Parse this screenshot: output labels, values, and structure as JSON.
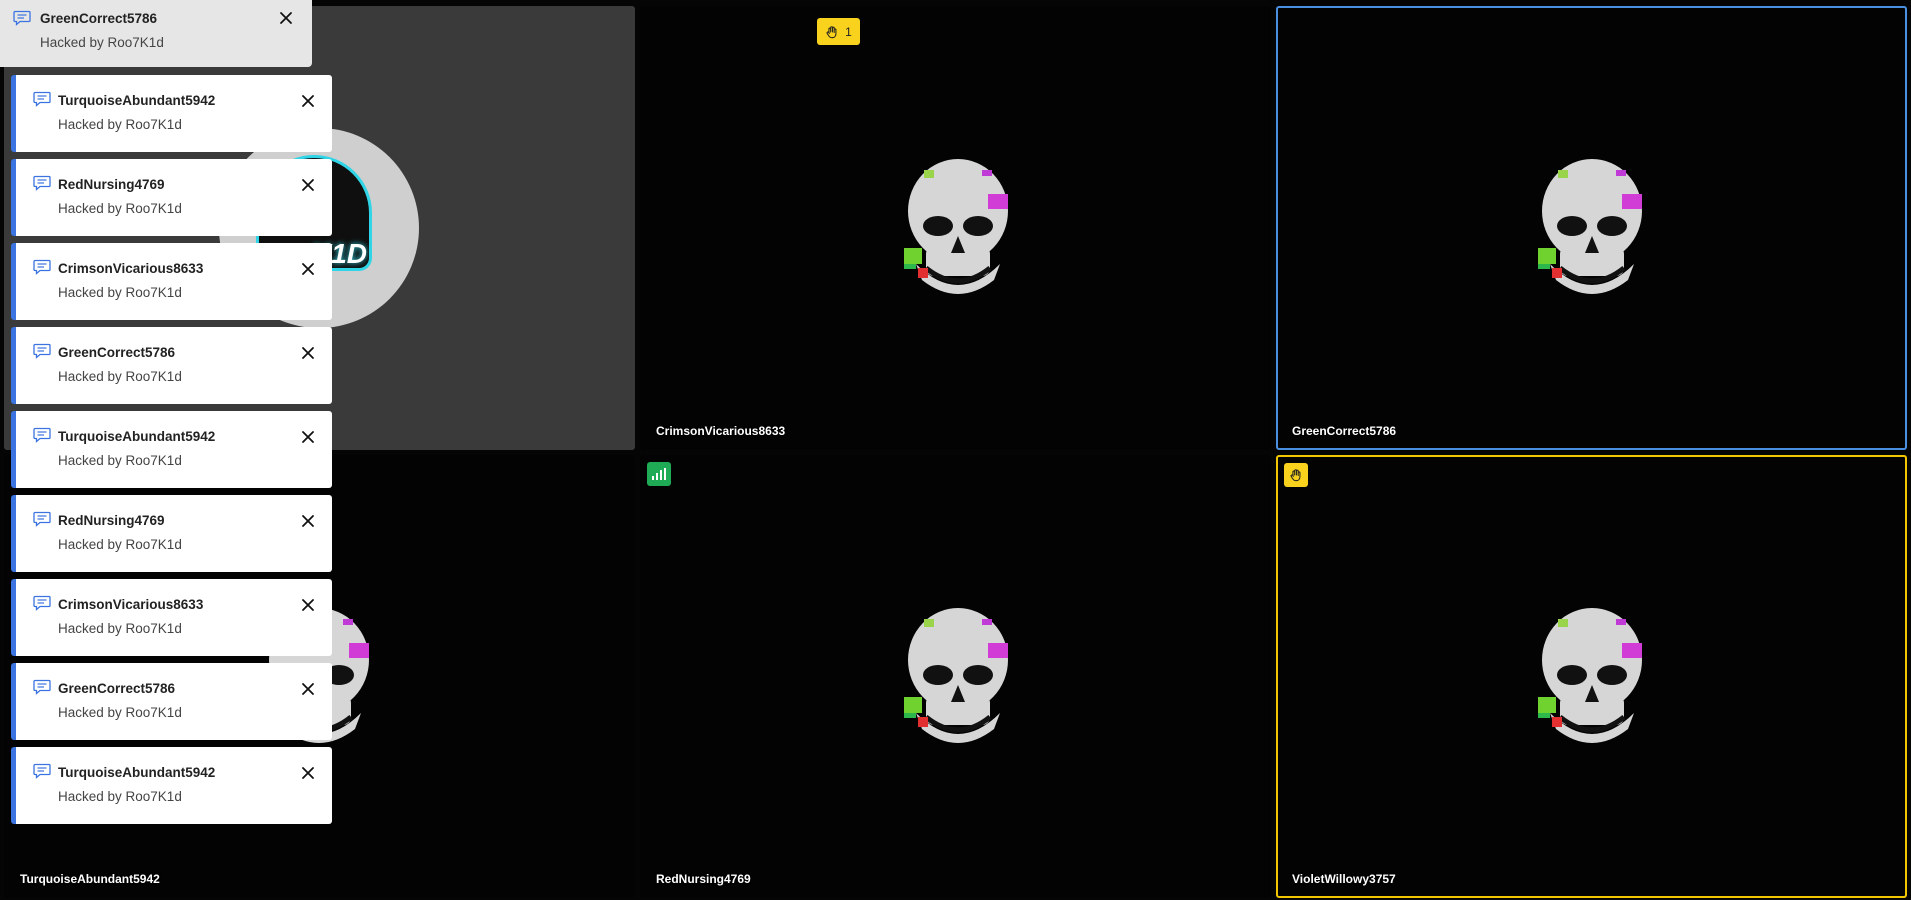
{
  "participants": [
    {
      "name": "",
      "type": "avatar",
      "avatar_text": "K1D"
    },
    {
      "name": "CrimsonVicarious8633",
      "badge": "hand-raise-count",
      "badge_count": "1"
    },
    {
      "name": "GreenCorrect5786",
      "active_speaker": true
    },
    {
      "name": "TurquoiseAbundant5942"
    },
    {
      "name": "RedNursing4769",
      "badge": "connection-quality"
    },
    {
      "name": "VioletWillowy3757",
      "badge": "hand-raise",
      "hand_raised": true
    }
  ],
  "notifications": [
    {
      "sender": "GreenCorrect5786",
      "message": "Hacked by Roo7K1d"
    },
    {
      "sender": "TurquoiseAbundant5942",
      "message": "Hacked by Roo7K1d"
    },
    {
      "sender": "RedNursing4769",
      "message": "Hacked by Roo7K1d"
    },
    {
      "sender": "CrimsonVicarious8633",
      "message": "Hacked by Roo7K1d"
    },
    {
      "sender": "GreenCorrect5786",
      "message": "Hacked by Roo7K1d"
    },
    {
      "sender": "TurquoiseAbundant5942",
      "message": "Hacked by Roo7K1d"
    },
    {
      "sender": "RedNursing4769",
      "message": "Hacked by Roo7K1d"
    },
    {
      "sender": "CrimsonVicarious8633",
      "message": "Hacked by Roo7K1d"
    },
    {
      "sender": "GreenCorrect5786",
      "message": "Hacked by Roo7K1d"
    },
    {
      "sender": "TurquoiseAbundant5942",
      "message": "Hacked by Roo7K1d"
    }
  ],
  "colors": {
    "active_speaker_border": "#4a90e2",
    "hand_raise_border": "#f2c600",
    "hand_badge": "#f8d21c",
    "signal_badge": "#1faa55",
    "toast_accent": "#3b73e0"
  },
  "icons": {
    "message": "chat-bubble-icon",
    "close": "close-icon",
    "hand": "raised-hand-icon",
    "signal": "signal-bars-icon"
  }
}
